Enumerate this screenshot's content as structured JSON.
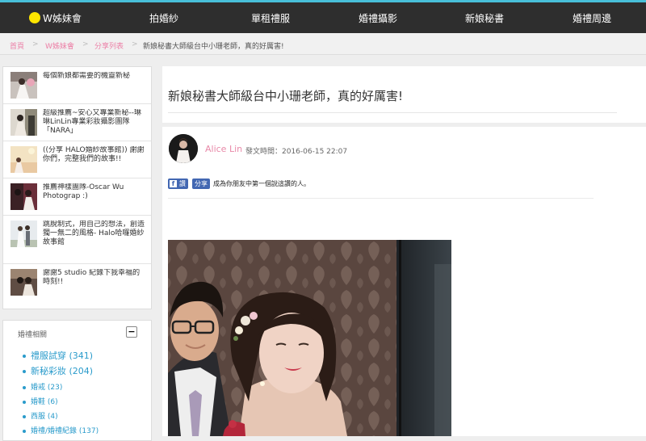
{
  "brand": {
    "name": "W姊妹會"
  },
  "nav": {
    "items": [
      {
        "label": "拍婚紗"
      },
      {
        "label": "單租禮服"
      },
      {
        "label": "婚禮攝影"
      },
      {
        "label": "新娘秘書"
      },
      {
        "label": "婚禮周邊"
      }
    ]
  },
  "breadcrumb": {
    "home": "首頁",
    "site": "W姊妹會",
    "list": "分享列表",
    "current": "新娘秘書大師級台中小珊老師，真的好厲害!",
    "separator": ">"
  },
  "sidebar": {
    "related_posts": [
      {
        "title": "每個新娘都需要的機靈新秘"
      },
      {
        "title": "超級推薦~安心又專業新秘--琳琳LinLin專業彩妝攝影團隊「NARA」"
      },
      {
        "title": "((分享 HALO婚紗故事館)) 謝謝你們，完整我們的故事!!"
      },
      {
        "title": "推薦神樣團隊-Oscar Wu Photograp :)"
      },
      {
        "title": "跳脫制式，用自己的想法，創造獨一無二的風格- Halo哈囉婚紗故事館"
      },
      {
        "title": "謝謝5 studio 紀錄下我幸福的時刻!!"
      }
    ],
    "categories": {
      "title": "婚禮相關",
      "toggle": "−",
      "items": [
        {
          "label": "禮服試穿 (341)"
        },
        {
          "label": "新秘彩妝 (204)"
        },
        {
          "label": "婚戒 (23)"
        },
        {
          "label": "婚鞋 (6)"
        },
        {
          "label": "西服 (4)"
        },
        {
          "label": "婚禮/婚禮紀錄 (137)"
        }
      ]
    }
  },
  "post": {
    "title": "新娘秘書大師級台中小珊老師，真的好厲害!",
    "author": "Alice Lin",
    "published": "發文時間：2016-06-15 22:07",
    "fb": {
      "like_label": "讚",
      "share_label": "分享",
      "prompt": "成為你朋友中第一個說這讚的人。"
    }
  },
  "colors": {
    "accent_top": "#48bfd9",
    "nav_bg": "#2e2e2e",
    "logo_dot": "#ffe600",
    "pink": "#ec7fa6",
    "link_blue": "#2a9bcb",
    "facebook": "#4267b2"
  },
  "icons": {
    "logo": "yellow-circle-icon",
    "facebook": "facebook-f-icon",
    "collapse": "minus-icon"
  }
}
